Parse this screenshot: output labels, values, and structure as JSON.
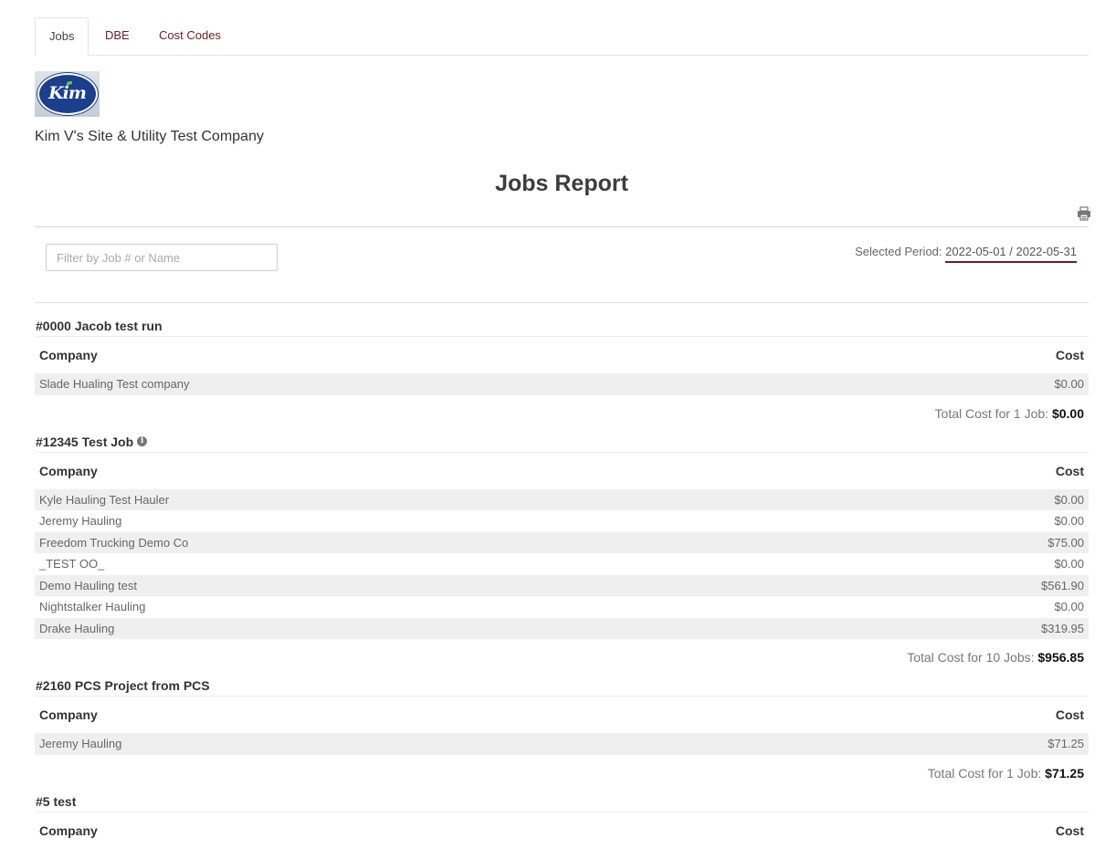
{
  "tabs": [
    {
      "label": "Jobs",
      "active": true
    },
    {
      "label": "DBE",
      "active": false
    },
    {
      "label": "Cost Codes",
      "active": false
    }
  ],
  "logo": {
    "text": "Kim",
    "colors": {
      "oval": "#1b3f8c",
      "leaf": "#6cc24a"
    }
  },
  "company_name": "Kim V's Site & Utility Test Company",
  "report_title": "Jobs Report",
  "filter": {
    "placeholder": "Filter by Job # or Name",
    "value": ""
  },
  "period": {
    "label": "Selected Period:",
    "value": "2022-05-01 / 2022-05-31"
  },
  "table_headers": {
    "company": "Company",
    "cost": "Cost"
  },
  "jobs": [
    {
      "title": "#0000 Jacob test run",
      "has_info": false,
      "rows": [
        {
          "company": "Slade Hualing Test company",
          "cost": "$0.00"
        }
      ],
      "total_label": "Total Cost for 1 Job:",
      "total_value": "$0.00"
    },
    {
      "title": "#12345 Test Job",
      "has_info": true,
      "rows": [
        {
          "company": "Kyle Hauling Test Hauler",
          "cost": "$0.00"
        },
        {
          "company": "Jeremy Hauling",
          "cost": "$0.00"
        },
        {
          "company": "Freedom Trucking Demo Co",
          "cost": "$75.00"
        },
        {
          "company": "_TEST OO_",
          "cost": "$0.00"
        },
        {
          "company": "Demo Hauling test",
          "cost": "$561.90"
        },
        {
          "company": "Nightstalker Hauling",
          "cost": "$0.00"
        },
        {
          "company": "Drake Hauling",
          "cost": "$319.95"
        }
      ],
      "total_label": "Total Cost for 10 Jobs:",
      "total_value": "$956.85"
    },
    {
      "title": "#2160 PCS Project from PCS",
      "has_info": false,
      "rows": [
        {
          "company": "Jeremy Hauling",
          "cost": "$71.25"
        }
      ],
      "total_label": "Total Cost for 1 Job:",
      "total_value": "$71.25"
    },
    {
      "title": "#5 test",
      "has_info": false,
      "rows": [],
      "total_label": "",
      "total_value": ""
    }
  ]
}
